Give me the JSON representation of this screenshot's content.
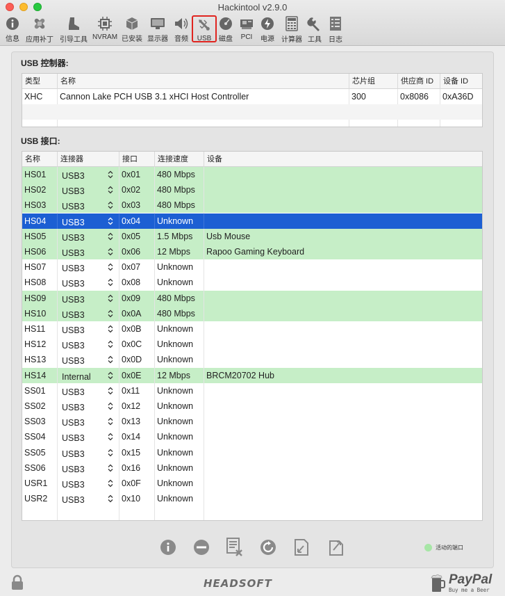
{
  "window": {
    "title": "Hackintool v2.9.0"
  },
  "toolbar": [
    {
      "label": "信息",
      "icon": "info-icon"
    },
    {
      "label": "应用补丁",
      "icon": "bandage-icon"
    },
    {
      "label": "引导工具",
      "icon": "boot-icon"
    },
    {
      "label": "NVRAM",
      "icon": "chip-icon"
    },
    {
      "label": "已安装",
      "icon": "box-icon"
    },
    {
      "label": "显示器",
      "icon": "display-icon"
    },
    {
      "label": "音频",
      "icon": "speaker-icon"
    },
    {
      "label": "USB",
      "icon": "usb-icon",
      "selected": true
    },
    {
      "label": "磁盘",
      "icon": "disk-icon"
    },
    {
      "label": "PCI",
      "icon": "pci-card-icon"
    },
    {
      "label": "电源",
      "icon": "power-bolt-icon"
    },
    {
      "label": "计算器",
      "icon": "calculator-icon"
    },
    {
      "label": "工具",
      "icon": "wrench-icon"
    },
    {
      "label": "日志",
      "icon": "log-icon"
    }
  ],
  "controllers": {
    "title": "USB 控制器:",
    "headers": [
      "类型",
      "名称",
      "芯片组",
      "供应商 ID",
      "设备 ID"
    ],
    "rows": [
      [
        "XHC",
        "Cannon Lake PCH USB 3.1 xHCI Host Controller",
        "300",
        "0x8086",
        "0xA36D"
      ]
    ]
  },
  "ports": {
    "title": "USB 接口:",
    "headers": [
      "名称",
      "连接器",
      "接口",
      "连接速度",
      "设备"
    ],
    "rows": [
      {
        "name": "HS01",
        "connector": "USB3",
        "port": "0x01",
        "speed": "480 Mbps",
        "device": "",
        "state": "active"
      },
      {
        "name": "HS02",
        "connector": "USB3",
        "port": "0x02",
        "speed": "480 Mbps",
        "device": "",
        "state": "active"
      },
      {
        "name": "HS03",
        "connector": "USB3",
        "port": "0x03",
        "speed": "480 Mbps",
        "device": "",
        "state": "active"
      },
      {
        "name": "HS04",
        "connector": "USB3",
        "port": "0x04",
        "speed": "Unknown",
        "device": "",
        "state": "selected"
      },
      {
        "name": "HS05",
        "connector": "USB3",
        "port": "0x05",
        "speed": "1.5 Mbps",
        "device": "Usb Mouse",
        "state": "active"
      },
      {
        "name": "HS06",
        "connector": "USB3",
        "port": "0x06",
        "speed": "12 Mbps",
        "device": "Rapoo Gaming Keyboard",
        "state": "active"
      },
      {
        "name": "HS07",
        "connector": "USB3",
        "port": "0x07",
        "speed": "Unknown",
        "device": "",
        "state": ""
      },
      {
        "name": "HS08",
        "connector": "USB3",
        "port": "0x08",
        "speed": "Unknown",
        "device": "",
        "state": ""
      },
      {
        "name": "HS09",
        "connector": "USB3",
        "port": "0x09",
        "speed": "480 Mbps",
        "device": "",
        "state": "active"
      },
      {
        "name": "HS10",
        "connector": "USB3",
        "port": "0x0A",
        "speed": "480 Mbps",
        "device": "",
        "state": "active"
      },
      {
        "name": "HS11",
        "connector": "USB3",
        "port": "0x0B",
        "speed": "Unknown",
        "device": "",
        "state": ""
      },
      {
        "name": "HS12",
        "connector": "USB3",
        "port": "0x0C",
        "speed": "Unknown",
        "device": "",
        "state": ""
      },
      {
        "name": "HS13",
        "connector": "USB3",
        "port": "0x0D",
        "speed": "Unknown",
        "device": "",
        "state": ""
      },
      {
        "name": "HS14",
        "connector": "Internal",
        "port": "0x0E",
        "speed": "12 Mbps",
        "device": "BRCM20702 Hub",
        "state": "active"
      },
      {
        "name": "SS01",
        "connector": "USB3",
        "port": "0x11",
        "speed": "Unknown",
        "device": "",
        "state": ""
      },
      {
        "name": "SS02",
        "connector": "USB3",
        "port": "0x12",
        "speed": "Unknown",
        "device": "",
        "state": ""
      },
      {
        "name": "SS03",
        "connector": "USB3",
        "port": "0x13",
        "speed": "Unknown",
        "device": "",
        "state": ""
      },
      {
        "name": "SS04",
        "connector": "USB3",
        "port": "0x14",
        "speed": "Unknown",
        "device": "",
        "state": ""
      },
      {
        "name": "SS05",
        "connector": "USB3",
        "port": "0x15",
        "speed": "Unknown",
        "device": "",
        "state": ""
      },
      {
        "name": "SS06",
        "connector": "USB3",
        "port": "0x16",
        "speed": "Unknown",
        "device": "",
        "state": ""
      },
      {
        "name": "USR1",
        "connector": "USB3",
        "port": "0x0F",
        "speed": "Unknown",
        "device": "",
        "state": ""
      },
      {
        "name": "USR2",
        "connector": "USB3",
        "port": "0x10",
        "speed": "Unknown",
        "device": "",
        "state": ""
      }
    ]
  },
  "actions": [
    {
      "icon": "info-icon"
    },
    {
      "icon": "remove-icon"
    },
    {
      "icon": "clear-list-icon"
    },
    {
      "icon": "refresh-icon"
    },
    {
      "icon": "import-icon"
    },
    {
      "icon": "export-icon"
    }
  ],
  "legend": {
    "label": "活动的端口"
  },
  "footer": {
    "brand": "HEADSOFT",
    "donate_title": "PayPal",
    "donate_sub": "Buy me a Beer"
  },
  "colors": {
    "active_row": "#c6eec7",
    "selected_row": "#1c5fd3",
    "toolbar_highlight": "#e0241f"
  }
}
